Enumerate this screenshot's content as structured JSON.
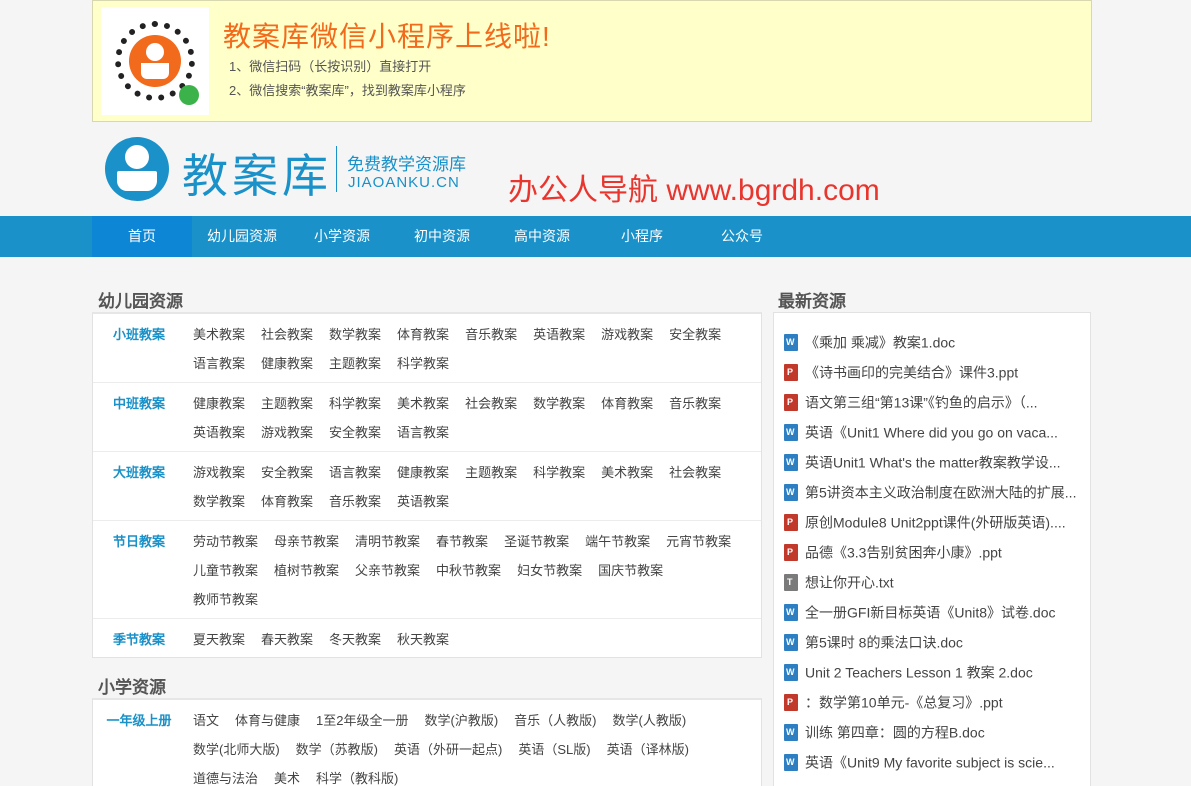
{
  "banner": {
    "title": "教案库微信小程序上线啦!",
    "line1": "1、微信扫码（长按识别）直接打开",
    "line2": "2、微信搜索“教案库”，找到教案库小程序"
  },
  "header": {
    "logo_text": "教案库",
    "logo_sub1": "免费教学资源库",
    "logo_sub2": "JIAOANKU.CN",
    "promo": "办公人导航  www.bgrdh.com"
  },
  "nav": [
    "首页",
    "幼儿园资源",
    "小学资源",
    "初中资源",
    "高中资源",
    "小程序",
    "公众号"
  ],
  "kindergarten": {
    "title": "幼儿园资源",
    "rows": [
      {
        "label": "小班教案",
        "links": [
          "美术教案",
          "社会教案",
          "数学教案",
          "体育教案",
          "音乐教案",
          "英语教案",
          "游戏教案",
          "安全教案",
          "语言教案",
          "健康教案",
          "主题教案",
          "科学教案"
        ]
      },
      {
        "label": "中班教案",
        "links": [
          "健康教案",
          "主题教案",
          "科学教案",
          "美术教案",
          "社会教案",
          "数学教案",
          "体育教案",
          "音乐教案",
          "英语教案",
          "游戏教案",
          "安全教案",
          "语言教案"
        ]
      },
      {
        "label": "大班教案",
        "links": [
          "游戏教案",
          "安全教案",
          "语言教案",
          "健康教案",
          "主题教案",
          "科学教案",
          "美术教案",
          "社会教案",
          "数学教案",
          "体育教案",
          "音乐教案",
          "英语教案"
        ]
      },
      {
        "label": "节日教案",
        "links": [
          "劳动节教案",
          "母亲节教案",
          "清明节教案",
          "春节教案",
          "圣诞节教案",
          "端午节教案",
          "元宵节教案",
          "儿童节教案",
          "植树节教案",
          "父亲节教案",
          "中秋节教案",
          "妇女节教案",
          "国庆节教案",
          "教师节教案"
        ]
      },
      {
        "label": "季节教案",
        "links": [
          "夏天教案",
          "春天教案",
          "冬天教案",
          "秋天教案"
        ]
      }
    ]
  },
  "primary": {
    "title": "小学资源",
    "rows": [
      {
        "label": "一年级上册",
        "links": [
          "语文",
          "体育与健康",
          "1至2年级全一册",
          "数学(沪教版)",
          "音乐（人教版)",
          "数学(人教版)",
          "数学(北师大版)",
          "数学（苏教版)",
          "英语（外研一起点)",
          "英语（SL版)",
          "英语（译林版)",
          "道德与法治",
          "美术",
          "科学（教科版)"
        ]
      }
    ]
  },
  "latest": {
    "title": "最新资源",
    "items": [
      {
        "type": "w",
        "text": "《乘加 乘减》教案1.doc"
      },
      {
        "type": "p",
        "text": "《诗书画印的完美结合》课件3.ppt"
      },
      {
        "type": "p",
        "text": "语文第三组“第13课”《钓鱼的启示》（..."
      },
      {
        "type": "w",
        "text": "英语《Unit1 Where did you go on vaca..."
      },
      {
        "type": "w",
        "text": "英语Unit1 What's the matter教案教学设..."
      },
      {
        "type": "w",
        "text": "第5讲资本主义政治制度在欧洲大陆的扩展..."
      },
      {
        "type": "p",
        "text": "原创Module8 Unit2ppt课件(外研版英语)...."
      },
      {
        "type": "p",
        "text": "品德《3.3告别贫困奔小康》.ppt"
      },
      {
        "type": "t",
        "text": "想让你开心.txt"
      },
      {
        "type": "w",
        "text": "全一册GFI新目标英语《Unit8》试卷.doc"
      },
      {
        "type": "w",
        "text": "第5课时 8的乘法口诀.doc"
      },
      {
        "type": "w",
        "text": "Unit 2 Teachers Lesson 1 教案 2.doc"
      },
      {
        "type": "p",
        "text": "：数学第10单元-《总复习》.ppt"
      },
      {
        "type": "w",
        "text": "训练 第四章：圆的方程B.doc"
      },
      {
        "type": "w",
        "text": "英语《Unit9 My favorite subject is scie..."
      }
    ]
  }
}
